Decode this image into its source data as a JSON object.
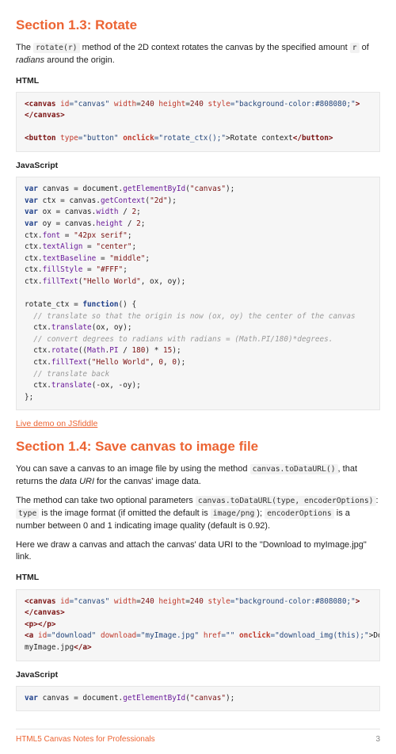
{
  "section13": {
    "heading": "Section 1.3: Rotate",
    "intro_pre": "The ",
    "intro_code1": "rotate(r)",
    "intro_mid": " method of the 2D context rotates the canvas by the specified amount ",
    "intro_code2": "r",
    "intro_post": " of ",
    "intro_em": "radians",
    "intro_tail": " around the origin.",
    "html_label": "HTML",
    "js_label": "JavaScript",
    "demo_link": "Live demo on JSfiddle",
    "html_code": {
      "l1_canvas_open": "<canvas",
      "l1_id_attr": " id",
      "l1_id_val": "=\"canvas\"",
      "l1_width_attr": " width",
      "l1_eq1": "=",
      "l1_width_val": "240",
      "l1_height_attr": " height",
      "l1_eq2": "=",
      "l1_height_val": "240",
      "l1_style_attr": " style",
      "l1_style_val": "=\"background-color:#808080;\"",
      "l1_close": ">",
      "l2_canvas_close": "</canvas>",
      "l3_button_open": "<button",
      "l3_type_attr": " type",
      "l3_type_val": "=\"button\"",
      "l3_onclick_attr": " onclick",
      "l3_onclick_val": "=\"rotate_ctx();\"",
      "l3_text": ">Rotate context",
      "l3_button_close": "</button>"
    },
    "js_code": {
      "l1_var": "var",
      "l1_rest": " canvas = document.",
      "l1_fn": "getElementById",
      "l1_p1": "(",
      "l1_str": "\"canvas\"",
      "l1_p2": ");",
      "l2_var": "var",
      "l2_mid": " ctx = canvas.",
      "l2_fn": "getContext",
      "l2_p1": "(",
      "l2_str": "\"2d\"",
      "l2_p2": ");",
      "l3_var": "var",
      "l3_mid": " ox = canvas.",
      "l3_fn": "width",
      "l3_rest": " / ",
      "l3_num": "2",
      "l3_end": ";",
      "l4_var": "var",
      "l4_mid": " oy = canvas.",
      "l4_fn": "height",
      "l4_rest": " / ",
      "l4_num": "2",
      "l4_end": ";",
      "l5_a": "ctx.",
      "l5_fn": "font",
      "l5_eq": " = ",
      "l5_str": "\"42px serif\"",
      "l5_end": ";",
      "l6_a": "ctx.",
      "l6_fn": "textAlign",
      "l6_eq": " = ",
      "l6_str": "\"center\"",
      "l6_end": ";",
      "l7_a": "ctx.",
      "l7_fn": "textBaseline",
      "l7_eq": " = ",
      "l7_str": "\"middle\"",
      "l7_end": ";",
      "l8_a": "ctx.",
      "l8_fn": "fillStyle",
      "l8_eq": " = ",
      "l8_str": "\"#FFF\"",
      "l8_end": ";",
      "l9_a": "ctx.",
      "l9_fn": "fillText",
      "l9_p1": "(",
      "l9_str": "\"Hello World\"",
      "l9_rest": ", ox, oy);",
      "l11_a": "rotate_ctx = ",
      "l11_kw": "function",
      "l11_b": "() {",
      "l12_cm": "  // translate so that the origin is now (ox, oy) the center of the canvas",
      "l13_a": "  ctx.",
      "l13_fn": "translate",
      "l13_rest": "(ox, oy);",
      "l14_cm": "  // convert degrees to radians with radians = (Math.PI/180)*degrees. ",
      "l15_a": "  ctx.",
      "l15_fn": "rotate",
      "l15_p1": "((",
      "l15_mp": "Math",
      "l15_dot": ".",
      "l15_pi": "PI",
      "l15_div": " / ",
      "l15_n1": "180",
      "l15_mul": ") * ",
      "l15_n2": "15",
      "l15_end": ");",
      "l16_a": "  ctx.",
      "l16_fn": "fillText",
      "l16_p1": "(",
      "l16_str": "\"Hello World\"",
      "l16_c1": ", ",
      "l16_n1": "0",
      "l16_c2": ", ",
      "l16_n2": "0",
      "l16_end": ");",
      "l17_cm": "  // translate back",
      "l18_a": "  ctx.",
      "l18_fn": "translate",
      "l18_rest": "(-ox, -oy);",
      "l19": "};"
    }
  },
  "section14": {
    "heading": "Section 1.4: Save canvas to image file",
    "p1_pre": "You can save a canvas to an image file by using the method ",
    "p1_code": "canvas.toDataURL()",
    "p1_mid": ", that returns the ",
    "p1_em": "data URI",
    "p1_post": " for the canvas' image data.",
    "p2_pre": "The method can take two optional parameters ",
    "p2_code1": "canvas.toDataURL(type, encoderOptions)",
    "p2_mid1": ": ",
    "p2_code2": "type",
    "p2_mid2": " is the image format (if omitted the default is ",
    "p2_code3": "image/png",
    "p2_mid3": "); ",
    "p2_code4": "encoderOptions",
    "p2_post": " is a number between 0 and 1 indicating image quality (default is 0.92).",
    "p3": "Here we draw a canvas and attach the canvas' data URI to the \"Download to myImage.jpg\" link.",
    "html_label": "HTML",
    "js_label": "JavaScript",
    "html_code": {
      "l1_canvas_open": "<canvas",
      "l1_id_attr": " id",
      "l1_id_val": "=\"canvas\"",
      "l1_width_attr": " width",
      "l1_eq1": "=",
      "l1_width_val": "240",
      "l1_height_attr": " height",
      "l1_eq2": "=",
      "l1_height_val": "240",
      "l1_style_attr": " style",
      "l1_style_val": "=\"background-color:#808080;\"",
      "l1_close": ">",
      "l2_canvas_close": "</canvas>",
      "l3_open": "<p></p>",
      "l4_a_open": "<a",
      "l4_id_attr": " id",
      "l4_id_val": "=\"download\"",
      "l4_dl_attr": " download",
      "l4_dl_val": "=\"myImage.jpg\"",
      "l4_href_attr": " href",
      "l4_href_val": "=\"\"",
      "l4_oc_attr": " onclick",
      "l4_oc_val": "=\"download_img(this);\"",
      "l4_text": ">Download to",
      "l5_text": "myImage.jpg",
      "l5_close": "</a>"
    },
    "js_code": {
      "l1_var": "var",
      "l1_rest": " canvas = document.",
      "l1_fn": "getElementById",
      "l1_p1": "(",
      "l1_str": "\"canvas\"",
      "l1_p2": ");"
    }
  },
  "footer": {
    "title": "HTML5 Canvas Notes for Professionals",
    "page": "3"
  }
}
